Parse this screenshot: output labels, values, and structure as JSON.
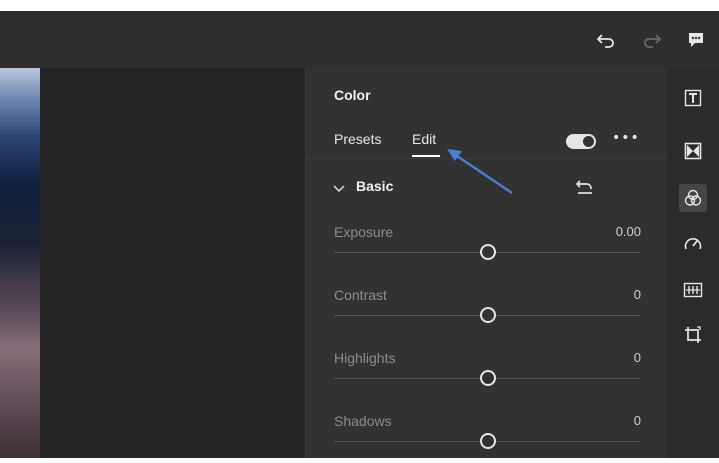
{
  "toolbar": {
    "undo_icon": "undo-icon",
    "redo_icon": "redo-icon",
    "feedback_icon": "comment-icon"
  },
  "panel": {
    "title": "Color",
    "tabs": [
      {
        "label": "Presets",
        "active": false
      },
      {
        "label": "Edit",
        "active": true
      }
    ],
    "toggle_on": true,
    "more_label": "•••"
  },
  "section": {
    "label": "Basic",
    "expanded": true
  },
  "sliders": [
    {
      "label": "Exposure",
      "value": "0.00",
      "position": 0.5
    },
    {
      "label": "Contrast",
      "value": "0",
      "position": 0.5
    },
    {
      "label": "Highlights",
      "value": "0",
      "position": 0.5
    },
    {
      "label": "Shadows",
      "value": "0",
      "position": 0.5
    }
  ],
  "rightbar": {
    "tools": [
      {
        "icon": "text-style-icon"
      },
      {
        "icon": "mask-icon"
      },
      {
        "icon": "color-circles-icon",
        "active": true
      },
      {
        "icon": "gauge-icon"
      },
      {
        "icon": "filmstrip-icon"
      },
      {
        "icon": "crop-icon"
      }
    ]
  },
  "colors": {
    "accent_arrow": "#4a7fd6",
    "panel_bg": "#323232",
    "topbar_bg": "#2e2e2e"
  }
}
